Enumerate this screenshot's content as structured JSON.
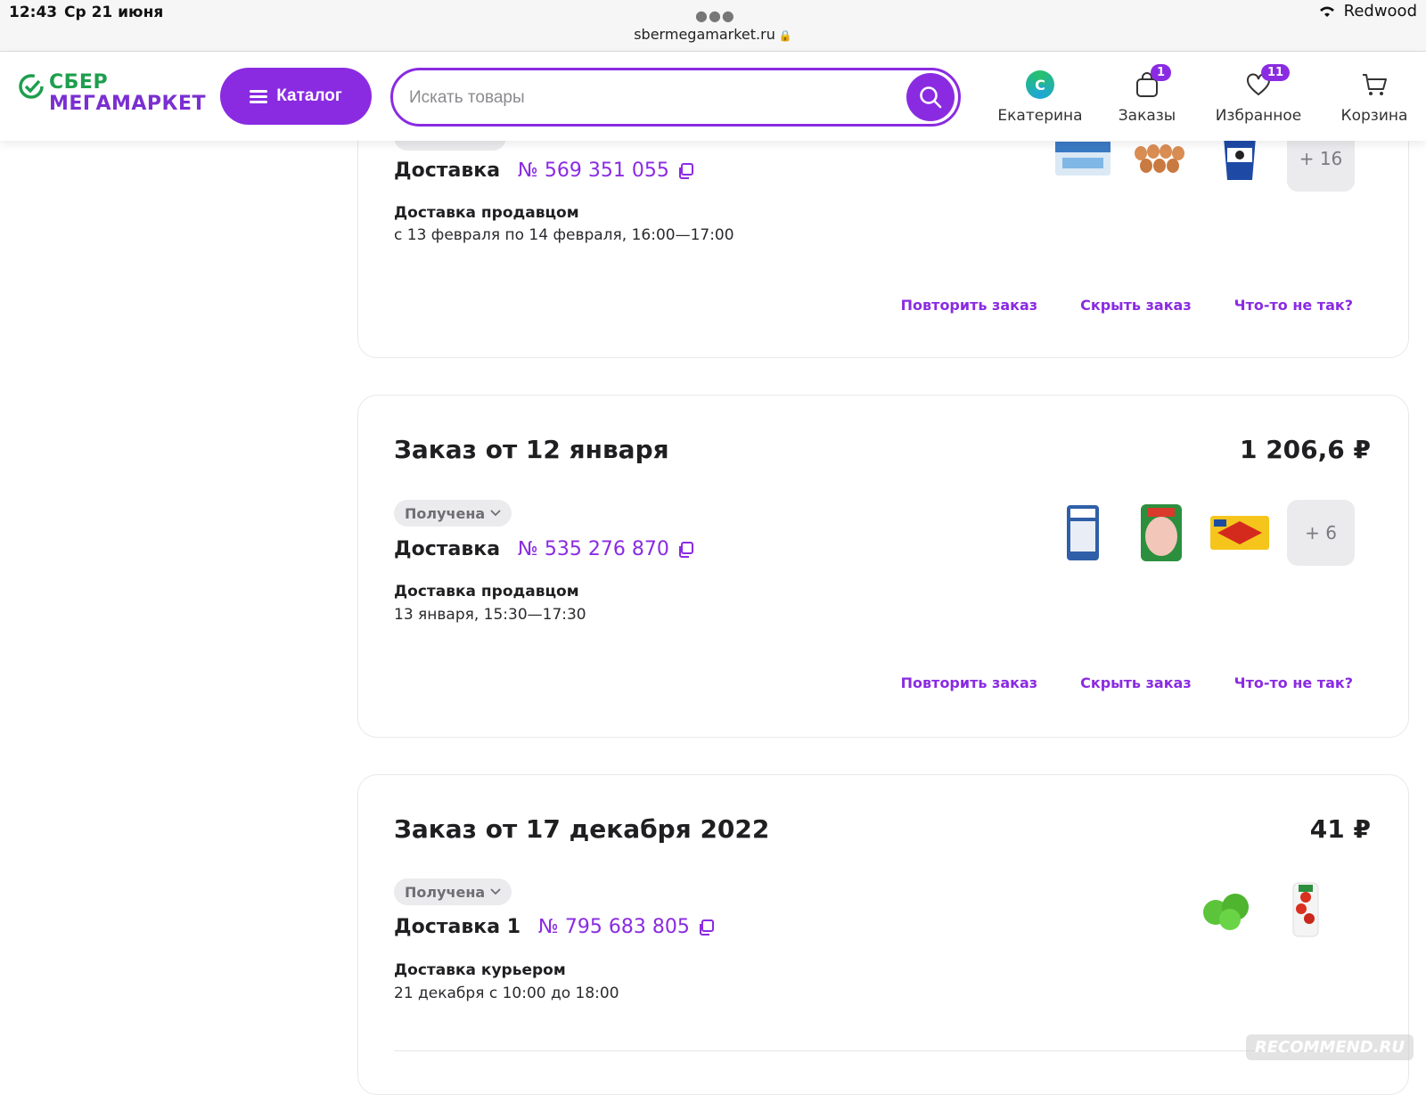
{
  "status_bar": {
    "time": "12:43",
    "date": "Ср 21 июня",
    "right_text": "Redwood",
    "url": "sbermegamarket.ru"
  },
  "header": {
    "logo_line1": "СБЕР",
    "logo_line2": "МЕГАМАРКЕТ",
    "catalog_label": "Каталог",
    "search_placeholder": "Искать товары",
    "nav": {
      "profile_label": "Екатерина",
      "orders_label": "Заказы",
      "orders_badge": "1",
      "favorites_label": "Избранное",
      "favorites_badge": "11",
      "cart_label": "Корзина"
    }
  },
  "orders": [
    {
      "title": "",
      "total": "",
      "delivery_label": "Доставка",
      "order_number": "№ 569 351 055",
      "method": "Доставка продавцом",
      "slot": "с 13 февраля по 14 февраля, 16:00—17:00",
      "more_count": "+ 16",
      "items": [
        "milk-carton",
        "eggs-tray",
        "sour-cream-cup"
      ]
    },
    {
      "title": "Заказ от 12 января",
      "total": "1 206,6 ₽",
      "status": "Получена",
      "delivery_label": "Доставка",
      "order_number": "№ 535 276 870",
      "method": "Доставка продавцом",
      "slot": "13 января, 15:30—17:30",
      "more_count": "+ 6",
      "items": [
        "rice-pack",
        "chicken-tray",
        "butter-pack"
      ]
    },
    {
      "title": "Заказ от 17 декабря 2022",
      "total": "41 ₽",
      "status": "Получена",
      "delivery_label": "Доставка 1",
      "order_number": "№ 795 683 805",
      "method": "Доставка курьером",
      "slot": "21 декабря с 10:00 до 18:00",
      "items": [
        "limes",
        "tomato-pack"
      ]
    }
  ],
  "actions": {
    "repeat": "Повторить заказ",
    "hide": "Скрыть заказ",
    "problem": "Что-то не так?"
  },
  "watermark": "RECOMMEND.RU",
  "colors": {
    "accent": "#8a2be2",
    "brand_green": "#1d9e4d",
    "status_bg": "#ebebee"
  }
}
